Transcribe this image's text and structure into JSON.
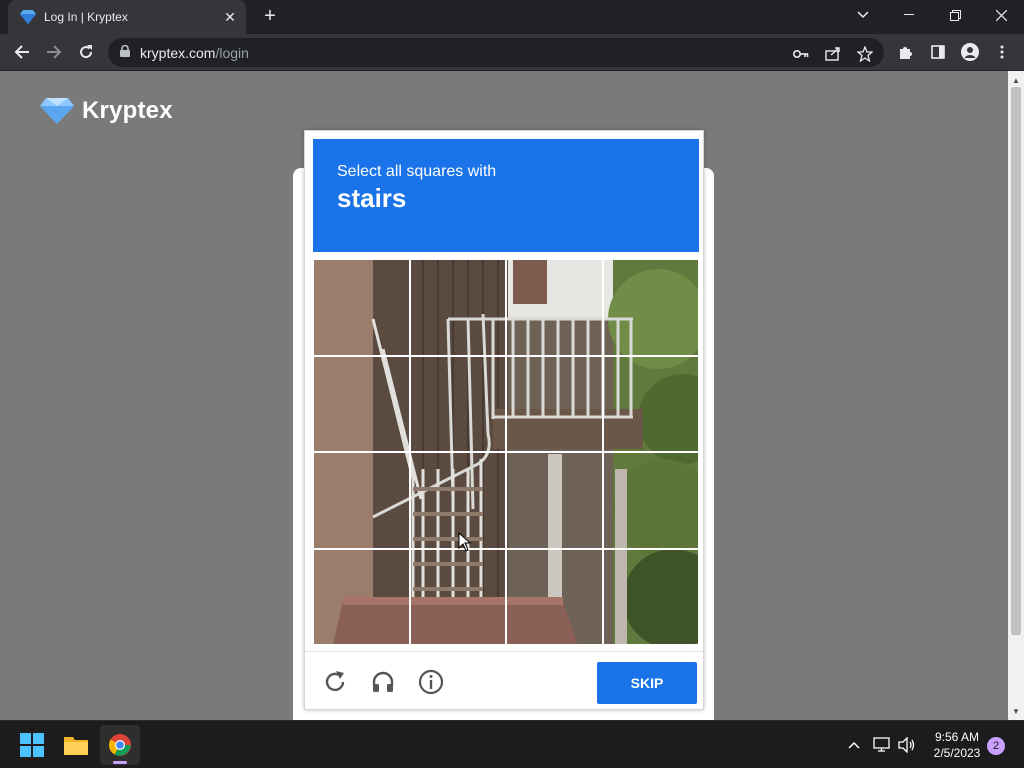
{
  "browser": {
    "tab_title": "Log In | Kryptex",
    "tab_close": "✕",
    "new_tab": "+",
    "url_host": "kryptex.com",
    "url_path": "/login"
  },
  "page": {
    "brand_name": "Kryptex"
  },
  "captcha": {
    "prompt": "Select all squares with",
    "target": "stairs",
    "skip_label": "SKIP",
    "grid_rows": 4,
    "grid_cols": 4
  },
  "taskbar": {
    "time": "9:56 AM",
    "date": "2/5/2023",
    "notification_count": "2"
  },
  "colors": {
    "accent": "#1a73e8",
    "page_bg": "#7a7a7a",
    "chrome_dark": "#202124",
    "chrome_toolbar": "#35363a"
  }
}
